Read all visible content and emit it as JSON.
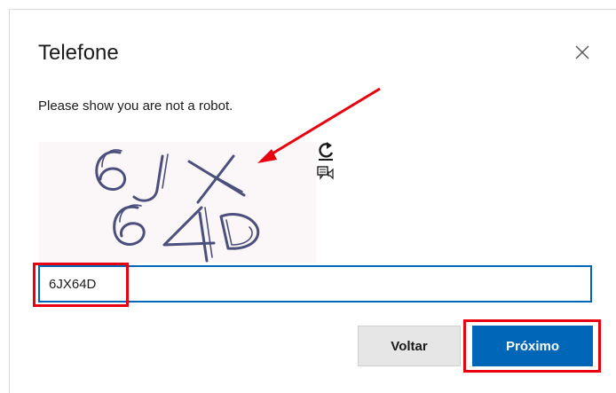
{
  "dialog": {
    "title": "Telefone",
    "instruction": "Please show you are not a robot.",
    "close_icon": "close-icon"
  },
  "captcha": {
    "challenge_text": "6JX64D",
    "refresh_icon": "refresh-icon",
    "audio_icon": "audio-icon",
    "input_value": "6JX64D"
  },
  "buttons": {
    "back_label": "Voltar",
    "next_label": "Próximo"
  },
  "colors": {
    "primary": "#0067b8",
    "highlight": "#e8000e",
    "captcha_stroke": "#4b4f7d",
    "captcha_bg": "#fbf6f7"
  }
}
